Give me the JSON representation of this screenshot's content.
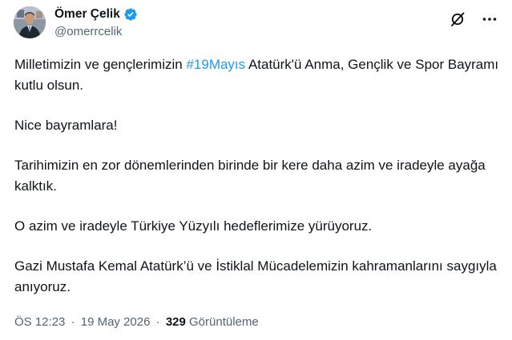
{
  "author": {
    "display_name": "Ömer Çelik",
    "handle": "@omerrcelik",
    "verified": true,
    "avatar_icon": "profile-photo",
    "verified_icon": "verified-badge-icon"
  },
  "header_actions": {
    "grok_icon": "grok-icon",
    "more_icon": "more-options-icon"
  },
  "tweet": {
    "p1_before": "Milletimizin ve gençlerimizin ",
    "p1_hashtag": "#19Mayıs",
    "p1_after": " Atatürk'ü Anma, Gençlik ve Spor Bayramı kutlu olsun.",
    "p2": "Nice bayramlara!",
    "p3": "Tarihimizin en zor dönemlerinden birinde bir kere daha azim ve iradeyle ayağa kalktık.",
    "p4": "O azim ve iradeyle Türkiye Yüzyılı hedeflerimize yürüyoruz.",
    "p5": "Gazi Mustafa Kemal Atatürk’ü ve İstiklal Mücadelemizin kahramanlarını saygıyla anıyoruz."
  },
  "meta": {
    "time": "ÖS 12:23",
    "separator": "·",
    "date": "19 May 2026",
    "separator2": "·",
    "views_count": "329",
    "views_label": "Görüntüleme"
  },
  "colors": {
    "accent": "#1d9bf0",
    "text": "#0f1419",
    "secondary": "#536471"
  }
}
